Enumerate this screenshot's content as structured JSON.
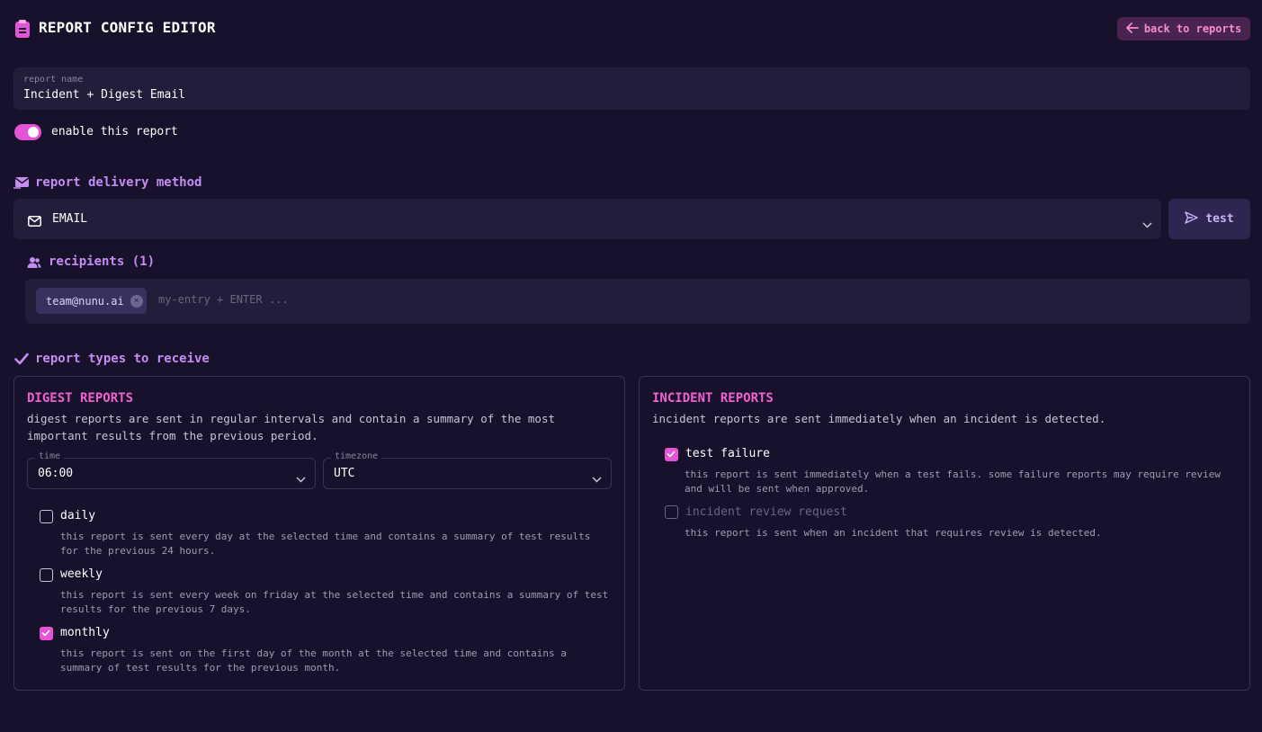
{
  "header": {
    "title": "REPORT CONFIG EDITOR",
    "icon": "clipboard-icon",
    "back_label": "back to reports"
  },
  "report_name": {
    "label": "report name",
    "value": "Incident + Digest Email"
  },
  "enable_toggle": {
    "label": "enable this report",
    "enabled": true
  },
  "delivery": {
    "heading": "report delivery method",
    "selected": "EMAIL",
    "test_label": "test"
  },
  "recipients": {
    "heading": "recipients (1)",
    "chips": [
      "team@nunu.ai"
    ],
    "placeholder": "my-entry + ENTER ..."
  },
  "report_types": {
    "heading": "report types to receive",
    "digest": {
      "title": "DIGEST REPORTS",
      "description": "digest reports are sent in regular intervals and contain a summary of the most important results from the previous period.",
      "time_label": "time",
      "time_value": "06:00",
      "timezone_label": "timezone",
      "timezone_value": "UTC",
      "options": [
        {
          "label": "daily",
          "checked": false,
          "description": "this report is sent every day at the selected time and contains a summary of test results for the previous 24 hours."
        },
        {
          "label": "weekly",
          "checked": false,
          "description": "this report is sent every week on friday at the selected time and contains a summary of test results for the previous 7 days."
        },
        {
          "label": "monthly",
          "checked": true,
          "description": "this report is sent on the first day of the month at the selected time and contains a summary of test results for the previous month."
        }
      ]
    },
    "incident": {
      "title": "INCIDENT REPORTS",
      "description": "incident reports are sent immediately when an incident is detected.",
      "options": [
        {
          "label": "test failure",
          "checked": true,
          "disabled": false,
          "description": "this report is sent immediately when a test fails. some failure reports may require review and will be sent when approved."
        },
        {
          "label": "incident review request",
          "checked": false,
          "disabled": true,
          "description": "this report is sent when an incident that requires review is detected."
        }
      ]
    }
  },
  "colors": {
    "background": "#17112b",
    "accent_pink": "#e454d4",
    "accent_purple": "#c58cf2",
    "field_bg": "#221d3a"
  }
}
